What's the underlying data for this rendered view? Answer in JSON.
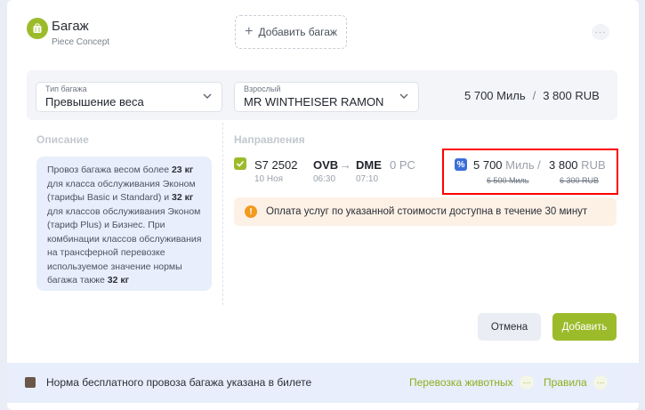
{
  "header": {
    "icon": "luggage-icon",
    "title": "Багаж",
    "subtitle": "Piece Concept",
    "add_bag_label": "Добавить багаж",
    "more_icon": "more-icon"
  },
  "selection_bar": {
    "baggage_type": {
      "label": "Тип багажа",
      "value": "Превышение веса"
    },
    "passenger": {
      "label": "Взрослый",
      "value": "MR WINTHEISER RAMON"
    },
    "price": {
      "miles": "5 700 Миль",
      "separator": "/",
      "rub": "3 800 RUB"
    }
  },
  "description": {
    "title": "Описание",
    "text_parts": [
      "Провоз багажа весом более ",
      "23 кг",
      " для класса обслуживания Эконом (тарифы Basic и Standard) и ",
      "32 кг",
      " для классов обслуживания Эконом (тариф Plus) и Бизнес. При комбинации классов обслуживания на трансферной перевозке используемое значение нормы багажа также ",
      "32 кг"
    ]
  },
  "directions": {
    "title": "Направления",
    "segment": {
      "checked": true,
      "flight": "S7  2502",
      "date": "10 Ноя",
      "from": "OVB",
      "to": "DME",
      "dep_time": "06:30",
      "arr_time": "07:10",
      "baggage_pc": "0 PC",
      "discount_icon": "%",
      "miles_value": "5 700",
      "miles_unit": "Миль",
      "separator": "/",
      "rub_value": "3 800",
      "rub_unit": "RUB",
      "old_miles": "6 500 Миль",
      "old_rub": "6 300 RUB"
    },
    "notice": {
      "icon": "!",
      "text": "Оплата услуг по указанной стоимости доступна в течение 30 минут"
    }
  },
  "actions": {
    "cancel": "Отмена",
    "add": "Добавить"
  },
  "footer": {
    "text": "Норма бесплатного провоза багажа указана в билете",
    "links": [
      "Перевозка животных",
      "Правила"
    ],
    "dots": "···"
  },
  "colors": {
    "accent": "#9cbb2b",
    "highlight": "#ff0000",
    "discount": "#3b6fd8",
    "warning": "#f29a1e"
  }
}
